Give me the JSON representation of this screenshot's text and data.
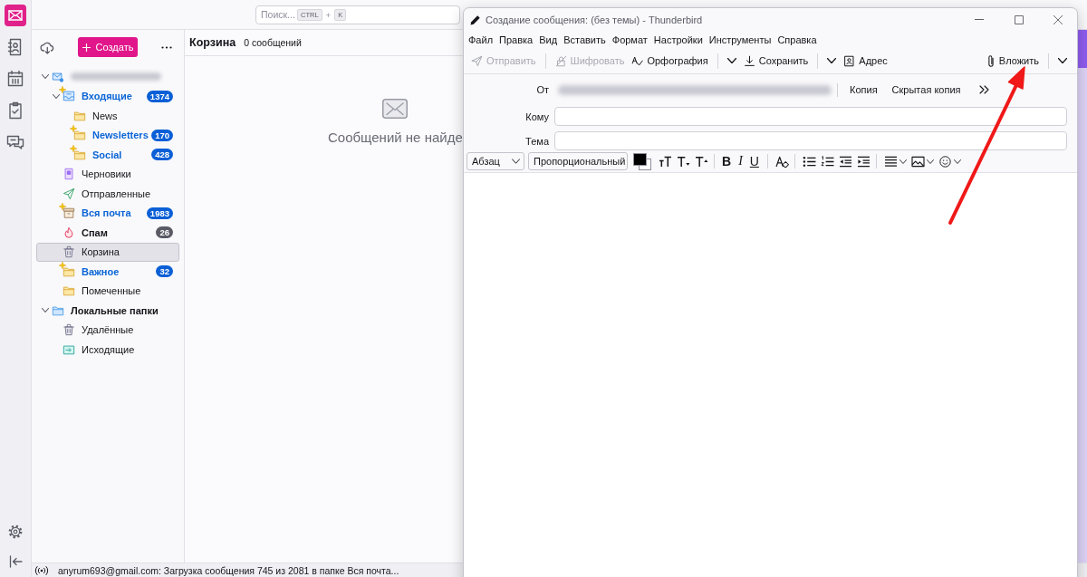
{
  "spaces_bar": {
    "items": [
      {
        "kind": "mail",
        "selected": true
      },
      {
        "kind": "address_book",
        "selected": false
      },
      {
        "kind": "calendar",
        "selected": false
      },
      {
        "kind": "tasks",
        "selected": false
      },
      {
        "kind": "chat",
        "selected": false
      }
    ]
  },
  "search": {
    "placeholder": "Поиск...",
    "keys": [
      "CTRL",
      "K"
    ],
    "joiner": "+"
  },
  "folder_pane": {
    "new_button": "Создать",
    "folders": [
      {
        "kind": "account",
        "expanded": true,
        "selected": false,
        "children": [
          {
            "kind": "inbox",
            "name": "Входящие",
            "new": true,
            "count": "1374",
            "expanded": true,
            "selected": false,
            "children": [
              {
                "kind": "folder",
                "name": "News",
                "new": false,
                "selected": false
              },
              {
                "kind": "folder",
                "name": "Newsletters",
                "new": true,
                "count": "170",
                "selected": false
              },
              {
                "kind": "folder",
                "name": "Social",
                "new": true,
                "count": "428",
                "selected": false
              }
            ]
          },
          {
            "kind": "drafts",
            "name": "Черновики",
            "new": false,
            "selected": false
          },
          {
            "kind": "sent",
            "name": "Отправленные",
            "new": false,
            "selected": false
          },
          {
            "kind": "archive",
            "name": "Вся почта",
            "new": true,
            "count": "1983",
            "selected": false
          },
          {
            "kind": "spam",
            "name": "Спам",
            "new": false,
            "count": "26",
            "selected": false
          },
          {
            "kind": "trash",
            "name": "Корзина",
            "new": false,
            "selected": true
          },
          {
            "kind": "folder",
            "name": "Важное",
            "new": true,
            "count": "32",
            "selected": false
          },
          {
            "kind": "folder",
            "name": "Помеченные",
            "new": false,
            "selected": false
          }
        ]
      },
      {
        "kind": "local",
        "name": "Локальные папки",
        "expanded": true,
        "selected": false,
        "children": [
          {
            "kind": "trash",
            "name": "Удалённые",
            "new": false,
            "selected": false
          },
          {
            "kind": "outbox",
            "name": "Исходящие",
            "new": false,
            "selected": false
          }
        ]
      }
    ]
  },
  "thread_pane": {
    "folder": "Корзина",
    "message_count": "0 сообщений",
    "empty_text": "Сообщений не найде"
  },
  "status_bar": {
    "text": "anyrum693@gmail.com: Загрузка сообщения 745 из 2081 в папке Вся почта..."
  },
  "compose": {
    "title": "Создание сообщения: (без темы) - Thunderbird",
    "menu": [
      "Файл",
      "Правка",
      "Вид",
      "Вставить",
      "Формат",
      "Настройки",
      "Инструменты",
      "Справка"
    ],
    "toolbar": [
      {
        "kind": "send",
        "label": "Отправить",
        "disabled": true,
        "dropdown": false
      },
      {
        "kind": "encrypt",
        "label": "Шифровать",
        "disabled": true,
        "dropdown": false
      },
      {
        "kind": "spelling",
        "label": "Орфография",
        "disabled": false,
        "dropdown": true
      },
      {
        "kind": "save",
        "label": "Сохранить",
        "disabled": false,
        "dropdown": true
      },
      {
        "kind": "address_book",
        "label": "Адрес",
        "disabled": false,
        "dropdown": false
      }
    ],
    "attach": {
      "label": "Вложить",
      "dropdown": true
    },
    "from_label": "От",
    "recipient_buttons": [
      "Копия",
      "Скрытая копия"
    ],
    "fields": [
      {
        "label": "Кому"
      },
      {
        "label": "Тема"
      }
    ],
    "format_bar": {
      "paragraph": "Абзац",
      "font": "Пропорциональный",
      "style_buttons": [
        "B",
        "I",
        "U"
      ]
    }
  }
}
